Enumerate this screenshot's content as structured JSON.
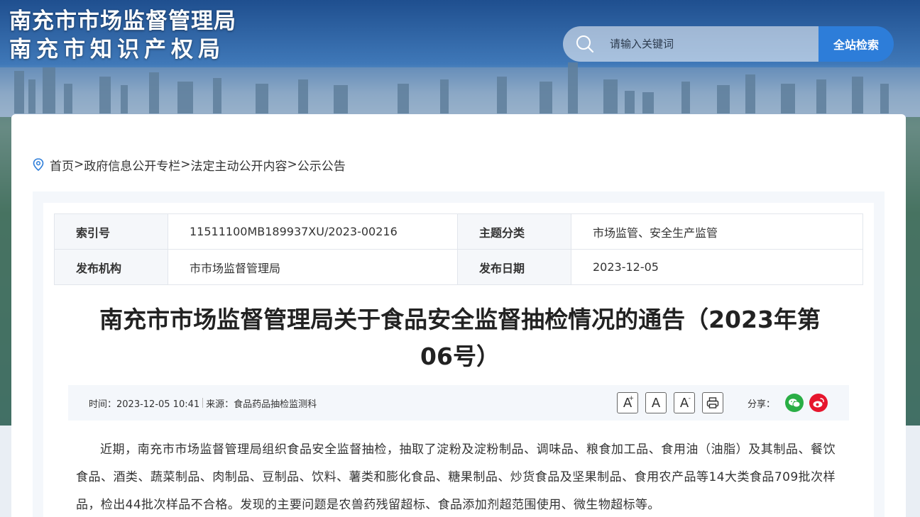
{
  "header": {
    "title_line1": "南充市市场监督管理局",
    "title_line2": "南充市知识产权局"
  },
  "search": {
    "placeholder": "请输入关键词",
    "button_label": "全站检索"
  },
  "breadcrumb": {
    "items": [
      "首页",
      "政府信息公开专栏",
      "法定主动公开内容",
      "公示公告"
    ],
    "separator": ">"
  },
  "meta": {
    "index_label": "索引号",
    "index_value": "11511100MB189937XU/2023-00216",
    "topic_label": "主题分类",
    "topic_value": "市场监管、安全生产监管",
    "publisher_label": "发布机构",
    "publisher_value": "市市场监督管理局",
    "date_label": "发布日期",
    "date_value": "2023-12-05"
  },
  "article": {
    "title": "南充市市场监督管理局关于食品安全监督抽检情况的通告（2023年第06号）",
    "time_text": "时间：2023-12-05 10:41",
    "source_text": "来源：食品药品抽检监测科",
    "share_label": "分享：",
    "font_larger": "A",
    "font_normal": "A",
    "font_smaller": "A",
    "body": "近期，南充市市场监督管理局组织食品安全监督抽检，抽取了淀粉及淀粉制品、调味品、粮食加工品、食用油（油脂）及其制品、餐饮食品、酒类、蔬菜制品、肉制品、豆制品、饮料、薯类和膨化食品、糖果制品、炒货食品及坚果制品、食用农产品等14大类食品709批次样品，检出44批次样品不合格。发现的主要问题是农兽药残留超标、食品添加剂超范围使用、微生物超标等。"
  },
  "colors": {
    "accent": "#2d7dd9",
    "wechat": "#2aae45",
    "weibo": "#e6162d"
  }
}
